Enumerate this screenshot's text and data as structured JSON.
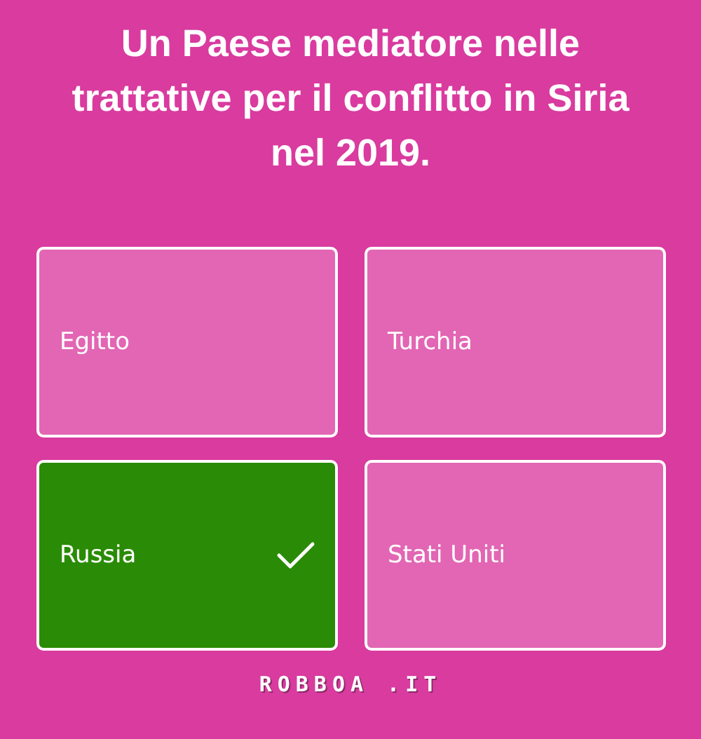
{
  "question": "Un Paese mediatore nelle trattative per il conflitto in Siria nel 2019.",
  "answers": [
    {
      "label": "Egitto",
      "correct": false
    },
    {
      "label": "Turchia",
      "correct": false
    },
    {
      "label": "Russia",
      "correct": true
    },
    {
      "label": "Stati Uniti",
      "correct": false
    }
  ],
  "footer": {
    "logo": "ROBBOA .IT"
  }
}
